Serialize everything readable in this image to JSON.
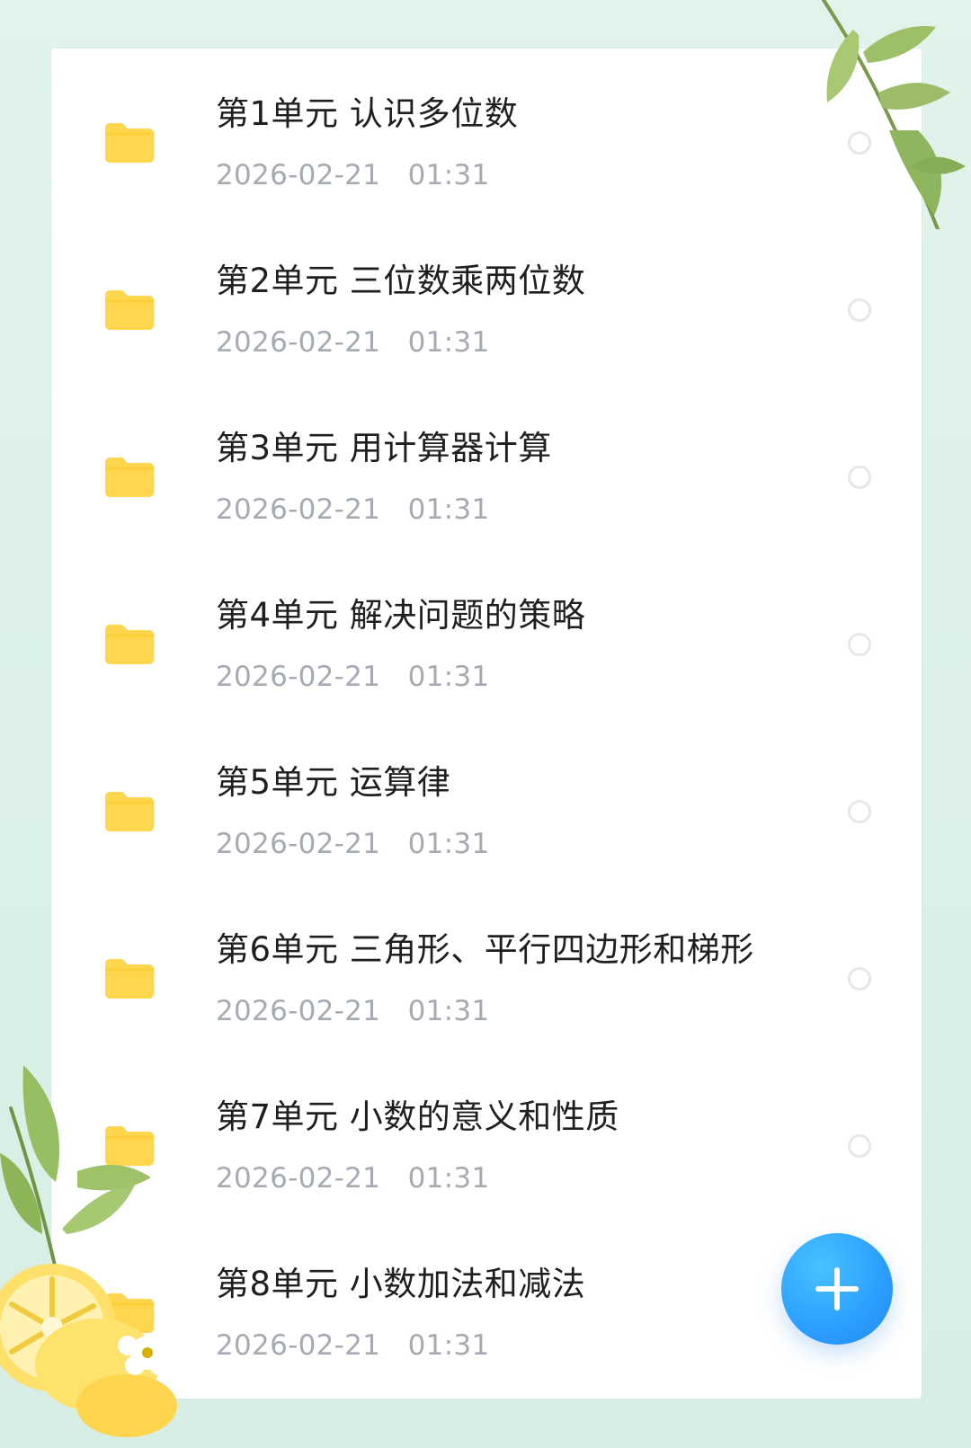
{
  "folders": [
    {
      "title": "第1单元 认识多位数",
      "date": "2026-02-21",
      "time": "01:31"
    },
    {
      "title": "第2单元 三位数乘两位数",
      "date": "2026-02-21",
      "time": "01:31"
    },
    {
      "title": "第3单元 用计算器计算",
      "date": "2026-02-21",
      "time": "01:31"
    },
    {
      "title": "第4单元 解决问题的策略",
      "date": "2026-02-21",
      "time": "01:31"
    },
    {
      "title": "第5单元 运算律",
      "date": "2026-02-21",
      "time": "01:31"
    },
    {
      "title": "第6单元 三角形、平行四边形和梯形",
      "date": "2026-02-21",
      "time": "01:31"
    },
    {
      "title": "第7单元 小数的意义和性质",
      "date": "2026-02-21",
      "time": "01:31"
    },
    {
      "title": "第8单元 小数加法和减法",
      "date": "2026-02-21",
      "time": "01:31"
    }
  ],
  "icons": {
    "folder": "folder-icon",
    "selection": "radio-circle",
    "fab": "plus-icon"
  },
  "colors": {
    "background": "#dcefe7",
    "card": "#ffffff",
    "folder": "#ffd64d",
    "title": "#1f1f1f",
    "meta": "#a6abb3",
    "radio": "#e5e7eb",
    "fab": "#2b9eff"
  }
}
